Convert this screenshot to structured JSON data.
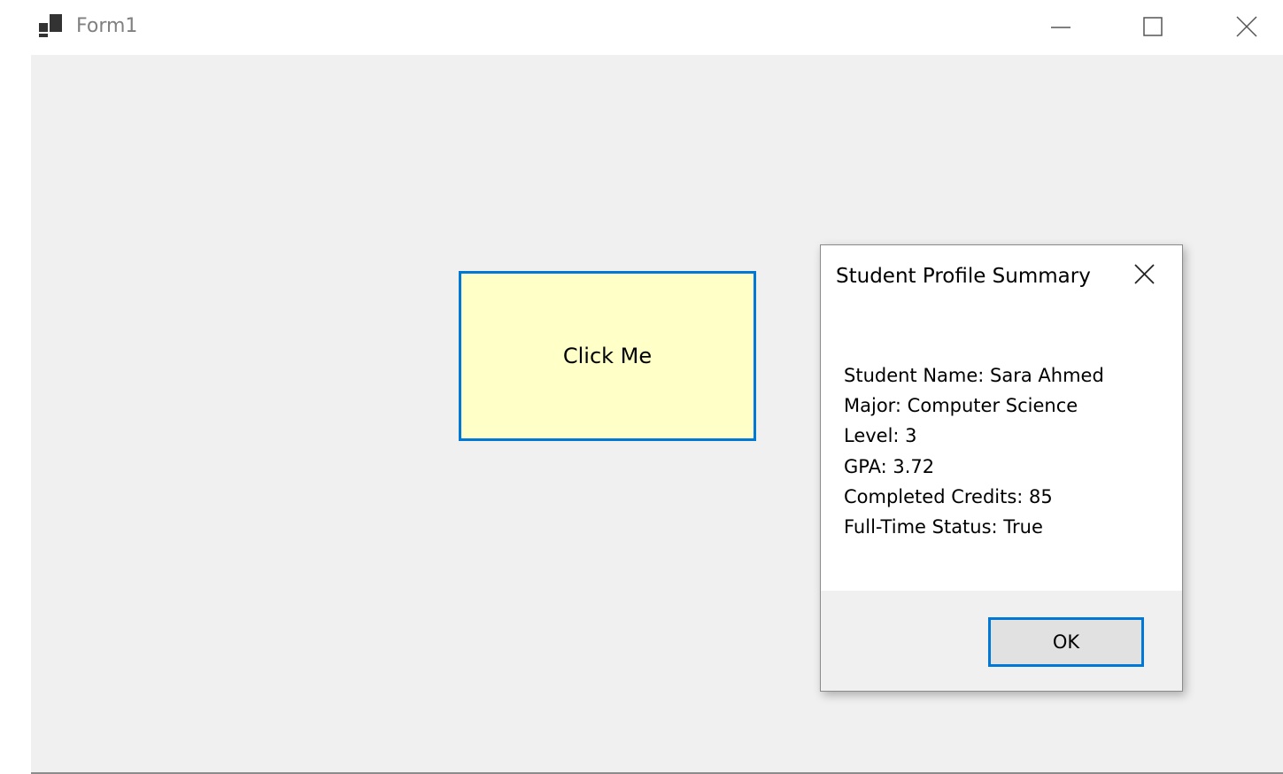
{
  "window": {
    "title": "Form1",
    "icon": "winforms-app-icon",
    "controls": [
      "minimize-icon",
      "maximize-icon",
      "close-icon"
    ]
  },
  "main": {
    "click_button_label": "Click Me",
    "click_button_bg": "#ffffc8",
    "accent": "#0078d7"
  },
  "dialog": {
    "title": "Student Profile Summary",
    "lines": [
      "Student Name: Sara Ahmed",
      "Major: Computer Science",
      "Level: 3",
      "GPA: 3.72",
      "Completed Credits: 85",
      "Full-Time Status: True"
    ],
    "ok_label": "OK"
  }
}
